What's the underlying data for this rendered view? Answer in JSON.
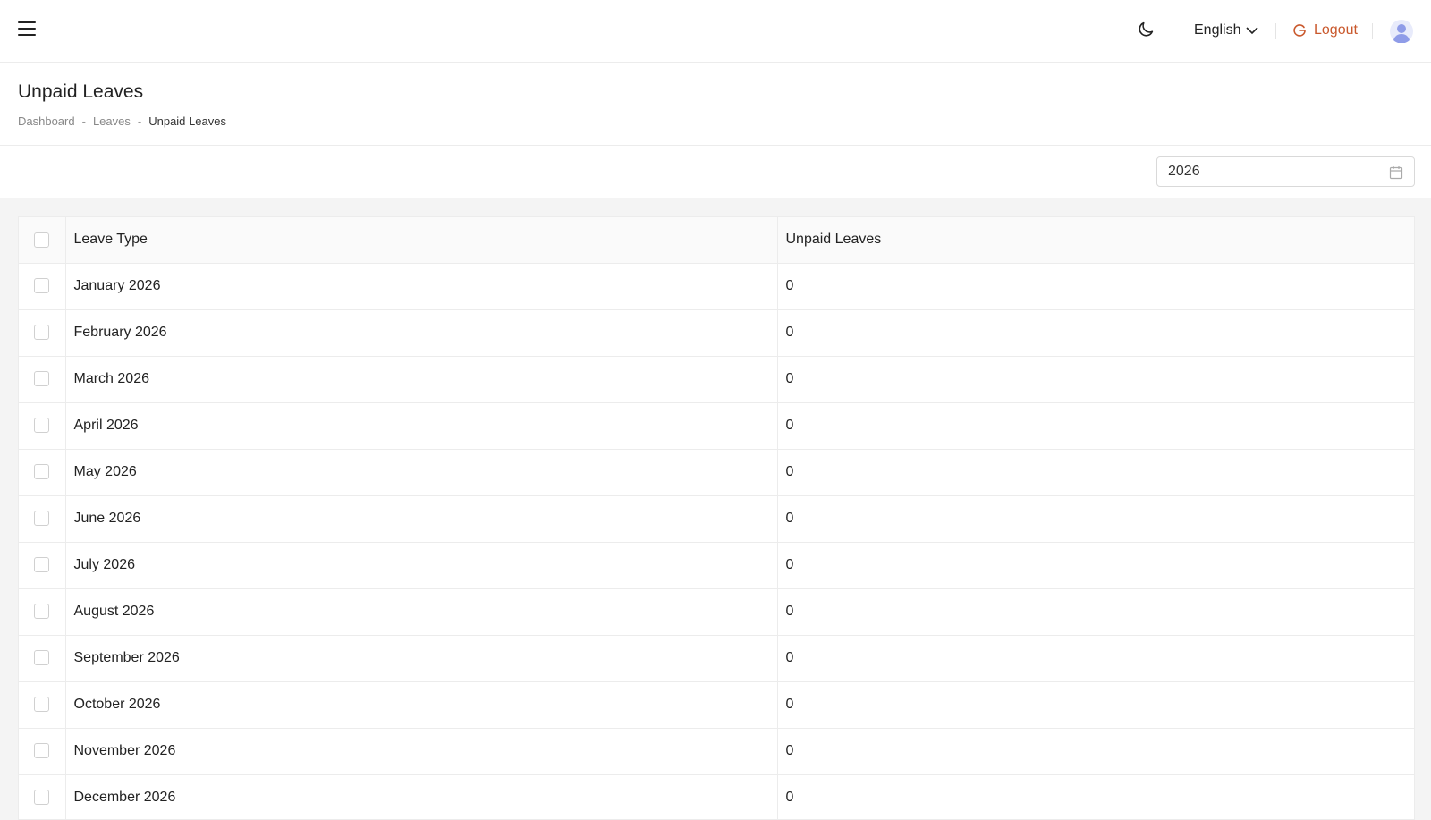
{
  "header": {
    "language": "English",
    "logout_label": "Logout"
  },
  "page": {
    "title": "Unpaid Leaves",
    "breadcrumb": [
      "Dashboard",
      "Leaves",
      "Unpaid Leaves"
    ]
  },
  "filter": {
    "year": "2026"
  },
  "table": {
    "columns": [
      "Leave Type",
      "Unpaid Leaves"
    ],
    "rows": [
      {
        "leave_type": "January 2026",
        "unpaid": "0"
      },
      {
        "leave_type": "February 2026",
        "unpaid": "0"
      },
      {
        "leave_type": "March 2026",
        "unpaid": "0"
      },
      {
        "leave_type": "April 2026",
        "unpaid": "0"
      },
      {
        "leave_type": "May 2026",
        "unpaid": "0"
      },
      {
        "leave_type": "June 2026",
        "unpaid": "0"
      },
      {
        "leave_type": "July 2026",
        "unpaid": "0"
      },
      {
        "leave_type": "August 2026",
        "unpaid": "0"
      },
      {
        "leave_type": "September 2026",
        "unpaid": "0"
      },
      {
        "leave_type": "October 2026",
        "unpaid": "0"
      },
      {
        "leave_type": "November 2026",
        "unpaid": "0"
      },
      {
        "leave_type": "December 2026",
        "unpaid": "0"
      }
    ]
  },
  "colors": {
    "accent_logout": "#c9582c",
    "avatar": "#8f9ce8"
  },
  "icons": [
    "menu-icon",
    "moon-icon",
    "chevron-down-icon",
    "logout-icon",
    "user-avatar-icon",
    "calendar-icon"
  ]
}
